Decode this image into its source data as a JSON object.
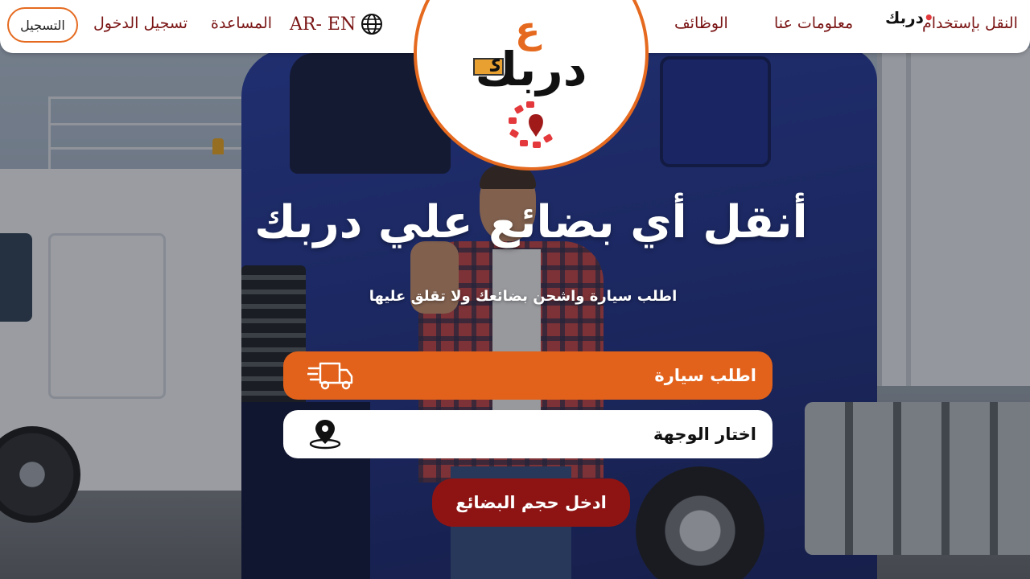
{
  "header": {
    "register_label": "التسجيل",
    "login_label": "تسجيل الدخول",
    "help_label": "المساعدة",
    "language_label": "AR- EN",
    "about_label": "معلومات عنا",
    "jobs_label": "الوظائف",
    "transport_label": "النقل بإستخدام",
    "brand_small": "دربك"
  },
  "logo": {
    "word": "دربك",
    "accent": "ع"
  },
  "hero": {
    "title": "أنقل أي بضائع علي دربك",
    "subtitle": "اطلب سيارة واشحن بضائعك ولا تقلق عليها"
  },
  "form": {
    "request_car_label": "اطلب سيارة",
    "destination_label": "اختار الوجهة",
    "cargo_button_label": "ادخل حجم البضائع"
  },
  "icons": {
    "language": "globe-icon",
    "request_car": "delivery-truck-icon",
    "destination": "location-pin-icon"
  },
  "colors": {
    "accent_orange": "#e2621b",
    "brand_dark_red": "#8e1414",
    "nav_text": "#7a1414",
    "logo_red": "#e4393c"
  }
}
